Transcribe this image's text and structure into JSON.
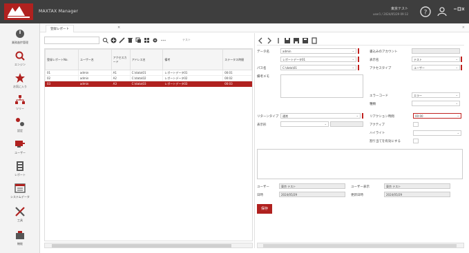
{
  "app": {
    "title": "MAXTAX Manager",
    "user_name": "東京テスト",
    "user_sub": "user1 / 2024/05/29 09:12"
  },
  "nav": [
    {
      "label": "業務進捗管理",
      "icon": "dashboard-icon"
    },
    {
      "label": "エンジン",
      "icon": "search-icon"
    },
    {
      "label": "お気に入り",
      "icon": "star-icon"
    },
    {
      "label": "ツリー",
      "icon": "tree-icon"
    },
    {
      "label": "設定",
      "icon": "settings-icon"
    },
    {
      "label": "ユーザー",
      "icon": "user-icon"
    },
    {
      "label": "レポート",
      "icon": "report-icon"
    },
    {
      "label": "システムデータ",
      "icon": "system-icon"
    },
    {
      "label": "工具",
      "icon": "tools-icon"
    },
    {
      "label": "機能",
      "icon": "feature-icon"
    }
  ],
  "tab": {
    "label": "登録レポート",
    "close": "×"
  },
  "left_panel": {
    "search_placeholder": "",
    "extra_label": "テスト"
  },
  "grid": {
    "columns": [
      "登録レポートNo.",
      "ユーザー名",
      "アクセスカード",
      "アドレス名",
      "備考",
      "ステータス時間"
    ],
    "rows": [
      [
        "01",
        "admin",
        "A1",
        "C:\\data\\01",
        "レポートデータ01",
        "00:01"
      ],
      [
        "02",
        "admin",
        "A2",
        "C:\\data\\02",
        "レポートデータ02",
        "00:02"
      ],
      [
        "03",
        "admin",
        "A3",
        "C:\\data\\03",
        "レポートデータ03",
        "00:03"
      ]
    ],
    "selected_index": 2
  },
  "form": {
    "l1_label": "データ名",
    "l1_value": "admin",
    "l2_label": "",
    "l2_value": "レポートデータ01",
    "l3_label": "パス名",
    "l3_value": "C:\\data\\01",
    "l4_label": "備考メモ",
    "r1_label": "書込みのアカウント",
    "r2_label": "表示名",
    "r2_value": "テスト",
    "r3_label": "アクセスタイプ",
    "r3_value": "ユーザー",
    "r4_label": "エラーコード",
    "r4_value": "エラー",
    "r5_label": "種類",
    "bottom1_label": "リターンタイプ",
    "bottom1_value": "通常",
    "bottom2_label": "表示形",
    "bottom3_label": "リアクション時間",
    "bottom3_value": "00:00",
    "bottom4_label": "アクティブ",
    "bottom5_label": "ハイライト",
    "bottom6_label": "割り当てを有効にする",
    "user_label": "ユーザー",
    "user_value": "東京 テスト",
    "user_label2": "ユーザー表示",
    "user_value2": "東京 テスト",
    "date_label": "日時",
    "date_value": "2024/05/29",
    "date_label2": "更新日時",
    "date_value2": "2024/05/29",
    "save_label": "保存"
  }
}
